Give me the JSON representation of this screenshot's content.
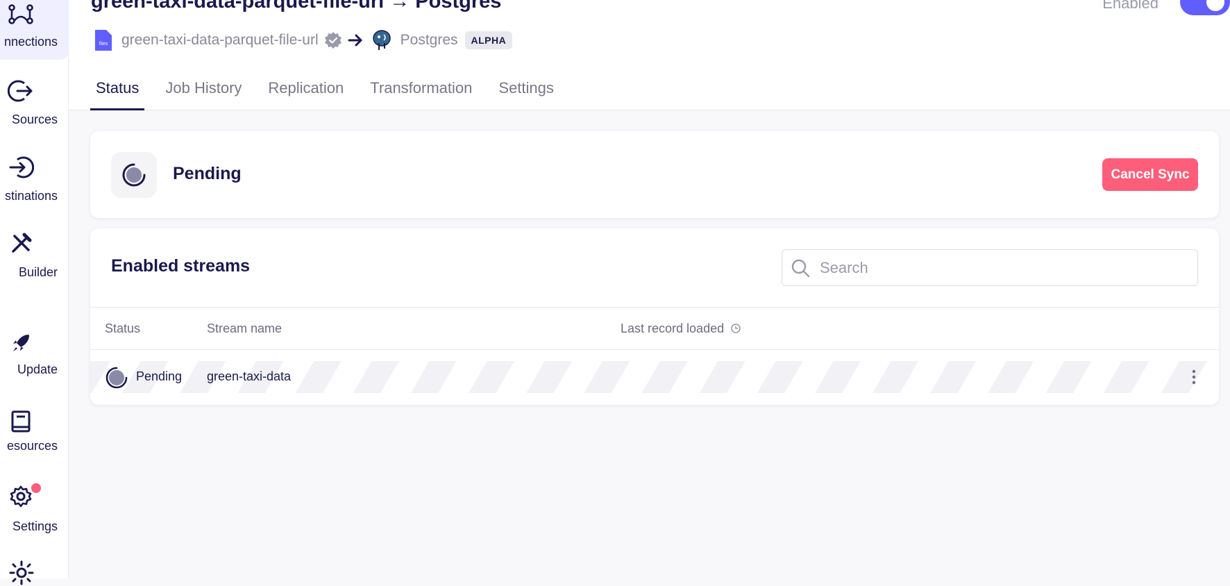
{
  "sidebar": {
    "items": [
      {
        "label": "nnections",
        "icon": "connections-icon"
      },
      {
        "label": "Sources",
        "icon": "sources-icon"
      },
      {
        "label": "stinations",
        "icon": "destinations-icon"
      },
      {
        "label": "Builder",
        "icon": "builder-icon"
      },
      {
        "label": "Update",
        "icon": "rocket-icon"
      },
      {
        "label": "esources",
        "icon": "book-icon"
      },
      {
        "label": "Settings",
        "icon": "gear-icon"
      }
    ]
  },
  "header": {
    "title": "green-taxi-data-parquet-file-url → Postgres",
    "enabled_label": "Enabled",
    "enabled": true,
    "source_name": "green-taxi-data-parquet-file-url",
    "destination_name": "Postgres",
    "destination_badge": "ALPHA",
    "file_icon_text": "files"
  },
  "tabs": [
    {
      "label": "Status",
      "active": true
    },
    {
      "label": "Job History",
      "active": false
    },
    {
      "label": "Replication",
      "active": false
    },
    {
      "label": "Transformation",
      "active": false
    },
    {
      "label": "Settings",
      "active": false
    }
  ],
  "status_card": {
    "status": "Pending",
    "cancel_label": "Cancel Sync"
  },
  "streams": {
    "title": "Enabled streams",
    "search_placeholder": "Search",
    "columns": [
      "Status",
      "Stream name",
      "Last record loaded"
    ],
    "rows": [
      {
        "status": "Pending",
        "stream_name": "green-taxi-data"
      }
    ]
  },
  "colors": {
    "accent": "#615eff",
    "danger": "#ff5e7b",
    "text_dark": "#1a194d"
  }
}
